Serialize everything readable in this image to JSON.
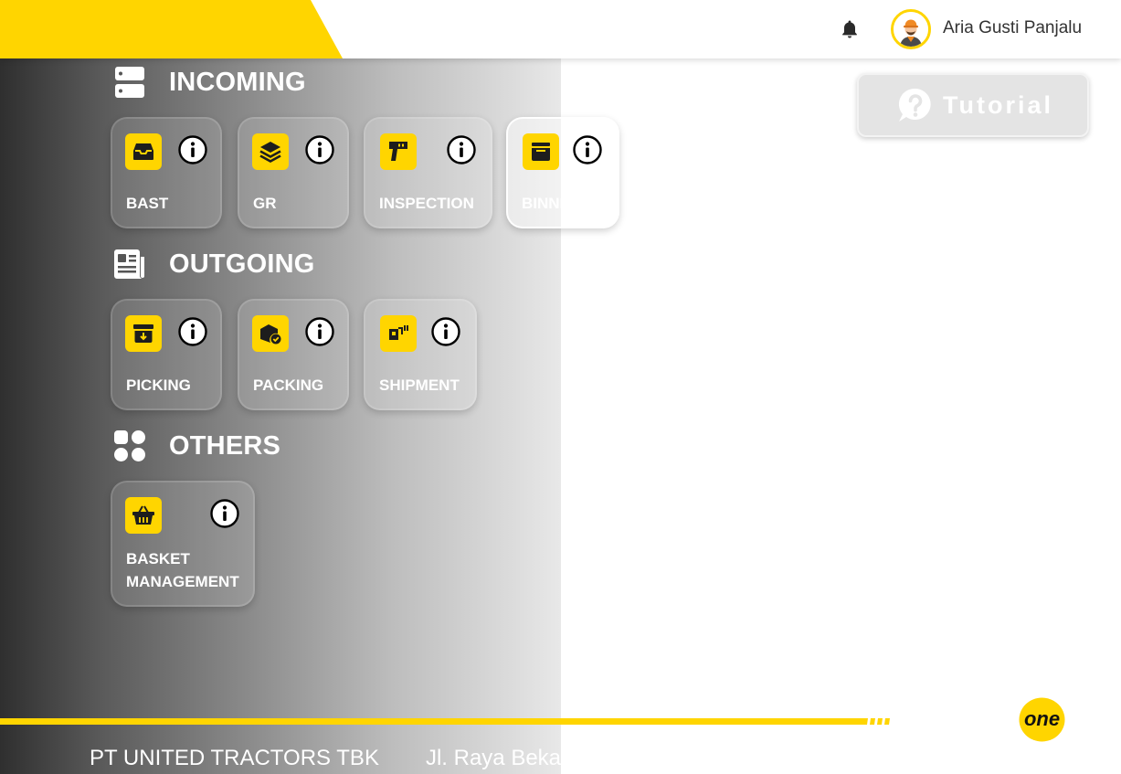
{
  "header": {
    "user_name": "Aria Gusti Panjalu",
    "accent_color": "#FFD500",
    "bell_icon": "bell-icon",
    "avatar_icon": "worker-avatar"
  },
  "sections": {
    "incoming": {
      "title": "INCOMING",
      "icon": "server-icon",
      "tiles": [
        {
          "label": "BAST",
          "icon": "inbox-icon"
        },
        {
          "label": "GR",
          "icon": "layers-icon"
        },
        {
          "label": "INSPECTION",
          "icon": "scanner-gun-icon"
        },
        {
          "label": "BINNING",
          "icon": "box-open-icon"
        }
      ]
    },
    "outgoing": {
      "title": "OUTGOING",
      "icon": "newspaper-icon",
      "tiles": [
        {
          "label": "PICKING",
          "icon": "archive-down-icon"
        },
        {
          "label": "PACKING",
          "icon": "package-check-icon"
        },
        {
          "label": "SHIPMENT",
          "icon": "forklift-icon"
        }
      ]
    },
    "others": {
      "title": "OTHERS",
      "icon": "grid-icon",
      "tiles": [
        {
          "label": "BASKET",
          "label_line2": "MANAGEMENT",
          "icon": "basket-icon"
        }
      ]
    }
  },
  "tutorial": {
    "label": "Tutorial",
    "icon": "question-icon"
  },
  "footer": {
    "company": "PT UNITED TRACTORS TBK",
    "address_fragment": "Jl. Raya Bekasi",
    "logo_text": "one"
  }
}
